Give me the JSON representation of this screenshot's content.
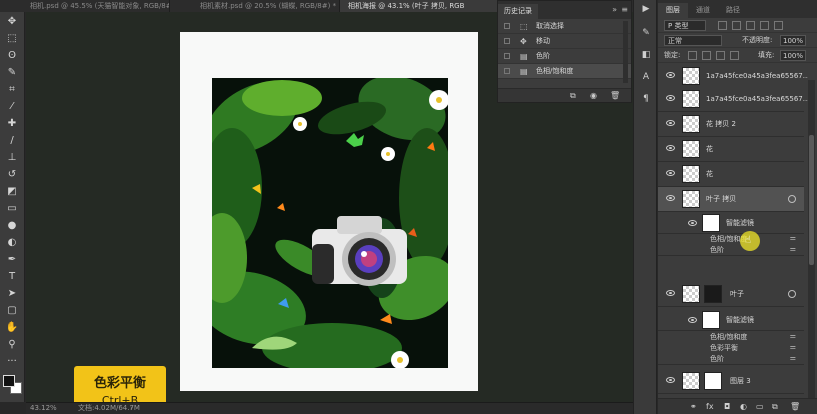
{
  "tabs": [
    {
      "label": "相机.psd @ 45.5% (天猫智能对象, RGB/8#) *",
      "active": false
    },
    {
      "label": "相机素材.psd @ 20.5% (蝴蝶, RGB/8#) *",
      "active": false
    },
    {
      "label": "相机海报 @ 43.1% (叶子 拷贝, RGB",
      "active": true
    }
  ],
  "history": {
    "title": "历史记录",
    "items": [
      {
        "label": "取消选择",
        "icon": "select-icon"
      },
      {
        "label": "移动",
        "icon": "move-icon"
      },
      {
        "label": "色阶",
        "icon": "levels-icon"
      },
      {
        "label": "色相/饱和度",
        "icon": "hue-saturation-icon",
        "selected": true
      }
    ]
  },
  "layers_panel": {
    "tabs": [
      "图层",
      "通道",
      "路径"
    ],
    "kind_filter": "P 类型",
    "blend_mode": "正常",
    "opacity_label": "不透明度:",
    "opacity": "100%",
    "lock_label": "锁定:",
    "fill_label": "填充:",
    "fill": "100%",
    "layers": [
      {
        "name": "1a7a45fce0a45a3fea65567...",
        "type": "smart"
      },
      {
        "name": "1a7a45fce0a45a3fea65567...",
        "type": "smart"
      },
      {
        "name": "花 拷贝 2",
        "type": "smart"
      },
      {
        "name": "花",
        "type": "smart"
      },
      {
        "name": "花",
        "type": "smart"
      },
      {
        "name": "叶子 拷贝",
        "type": "smart",
        "highlighted": true
      },
      {
        "name": "智能滤镜",
        "type": "filter-mask"
      },
      {
        "name": "色相/饱和度",
        "type": "filter"
      },
      {
        "name": "色阶",
        "type": "filter"
      },
      {
        "name": "叶子",
        "type": "smart-masked"
      },
      {
        "name": "智能滤镜",
        "type": "filter-mask"
      },
      {
        "name": "色相/饱和度",
        "type": "filter"
      },
      {
        "name": "色彩平衡",
        "type": "filter"
      },
      {
        "name": "色阶",
        "type": "filter"
      },
      {
        "name": "图层 3",
        "type": "layer"
      }
    ]
  },
  "hint": {
    "title": "色彩平衡",
    "shortcut": "Ctrl+B"
  },
  "status": {
    "zoom": "43.12%",
    "doc": "文档:4.02M/64.7M"
  },
  "colors": {
    "accent": "#f2c318",
    "canvas_bg": "#252a24",
    "panel": "#3c3c3c"
  }
}
